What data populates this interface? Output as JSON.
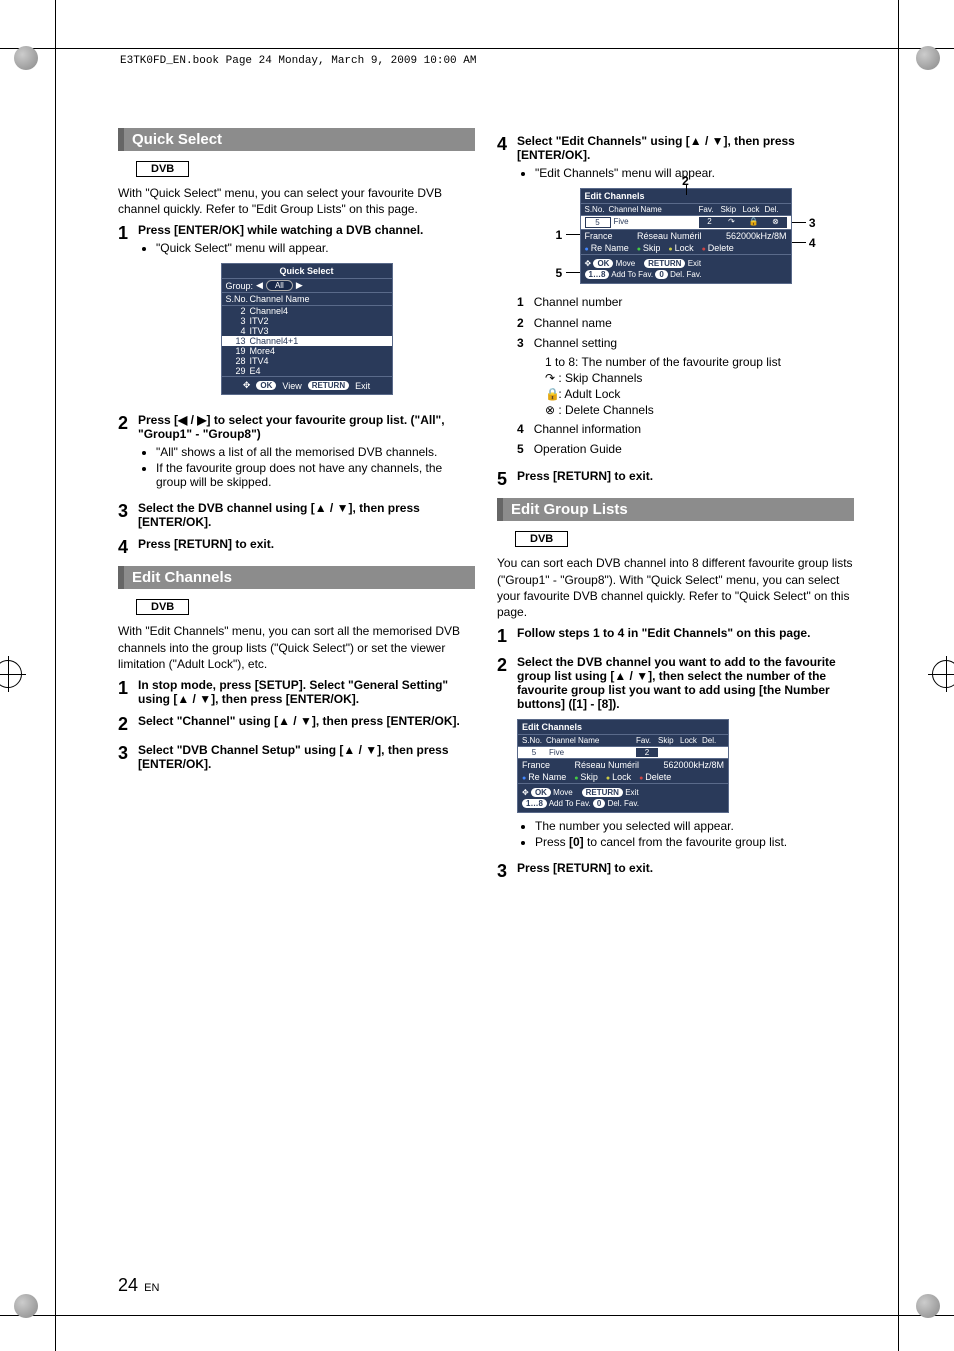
{
  "header": "E3TK0FD_EN.book  Page 24  Monday, March 9, 2009  10:00 AM",
  "page_number_big": "24",
  "page_number_suffix": "EN",
  "sections": {
    "quick_select": {
      "title": "Quick Select",
      "tag": "DVB",
      "intro": "With \"Quick Select\" menu, you can select your favourite DVB channel quickly. Refer to \"Edit Group Lists\" on this page.",
      "steps": {
        "s1_lead": "Press [ENTER/OK] while watching a DVB channel.",
        "s1_b1": "\"Quick Select\" menu will appear.",
        "s2_lead": "Press [◀ / ▶] to select your favourite group list. (\"All\", \"Group1\" - \"Group8\")",
        "s2_b1": "\"All\" shows a list of all the memorised DVB channels.",
        "s2_b2": "If the favourite group does not have any channels, the group will be skipped.",
        "s3_lead": "Select the DVB channel using [▲ / ▼], then press [ENTER/OK].",
        "s4_lead": "Press [RETURN] to exit."
      },
      "ui": {
        "title": "Quick Select",
        "group_label": "Group:",
        "group_value": "All",
        "col_sno": "S.No.",
        "col_name": "Channel Name",
        "items": [
          {
            "sno": "2",
            "name": "Channel4"
          },
          {
            "sno": "3",
            "name": "ITV2"
          },
          {
            "sno": "4",
            "name": "ITV3"
          },
          {
            "sno": "13",
            "name": "Channel4+1"
          },
          {
            "sno": "19",
            "name": "More4"
          },
          {
            "sno": "28",
            "name": "ITV4"
          },
          {
            "sno": "29",
            "name": "E4"
          }
        ],
        "foot_ok": "OK",
        "foot_view": "View",
        "foot_return": "RETURN",
        "foot_exit": "Exit"
      }
    },
    "edit_channels": {
      "title": "Edit Channels",
      "tag": "DVB",
      "intro": "With \"Edit Channels\" menu, you can sort all the memorised DVB channels into the group lists (\"Quick Select\") or set the viewer limitation (\"Adult Lock\"), etc.",
      "steps": {
        "s1_lead": "In stop mode, press [SETUP]. Select \"General Setting\" using [▲ / ▼], then press [ENTER/OK].",
        "s2_lead": "Select \"Channel\" using [▲ / ▼], then press [ENTER/OK].",
        "s3_lead": "Select \"DVB Channel Setup\" using [▲ / ▼], then press [ENTER/OK].",
        "s4_lead": "Select \"Edit Channels\" using [▲ / ▼], then press [ENTER/OK].",
        "s4_b1": "\"Edit Channels\" menu will appear."
      },
      "ui": {
        "title": "Edit Channels",
        "col_sno": "S.No.",
        "col_name": "Channel Name",
        "col_fav": "Fav.",
        "col_skip": "Skip",
        "col_lock": "Lock",
        "col_del": "Del.",
        "row_sno": "5",
        "row_name": "Five",
        "row_fav": "2",
        "row_skip": "↷",
        "row_lock": "🔒",
        "row_del": "⊗",
        "info_country": "France",
        "info_mux": "Réseau Numéril",
        "info_freq": "562000kHz/8M",
        "ops_rename": "Re Name",
        "ops_skip": "Skip",
        "ops_lock": "Lock",
        "ops_delete": "Delete",
        "guide_ok": "OK",
        "guide_move": "Move",
        "guide_return": "RETURN",
        "guide_exit": "Exit",
        "guide_addfav": "Add To Fav.",
        "guide_delfav": "Del. Fav.",
        "guide_numbtn": "1…8"
      },
      "legend": {
        "l1": "Channel number",
        "l2": "Channel name",
        "l3": "Channel setting",
        "l3a": "1 to 8: The number of the favourite group list",
        "l3b": ": Skip Channels",
        "l3c": ": Adult Lock",
        "l3d": ": Delete Channels",
        "l4": "Channel information",
        "l5": "Operation Guide"
      },
      "s5_lead": "Press [RETURN] to exit."
    },
    "edit_group": {
      "title": "Edit Group Lists",
      "tag": "DVB",
      "intro": "You can sort each DVB channel into 8 different favourite group lists (\"Group1\" - \"Group8\"). With \"Quick Select\" menu, you can select your favourite DVB channel quickly. Refer to \"Quick Select\" on this page.",
      "steps": {
        "s1_lead": "Follow steps 1 to 4 in \"Edit Channels\" on this page.",
        "s2_lead": "Select the DVB channel you want to add to the favourite group list using [▲ / ▼], then select the number of the favourite group list you want to add using [the Number buttons] ([1] - [8]).",
        "s2_b1": "The number you selected will appear.",
        "s2_b2_a": "Press ",
        "s2_b2_b": "[0]",
        "s2_b2_c": " to cancel from the favourite group list.",
        "s3_lead": "Press [RETURN] to exit."
      },
      "ui": {
        "title": "Edit Channels",
        "row_sno": "5",
        "row_name": "Five",
        "row_fav": "2"
      }
    }
  }
}
